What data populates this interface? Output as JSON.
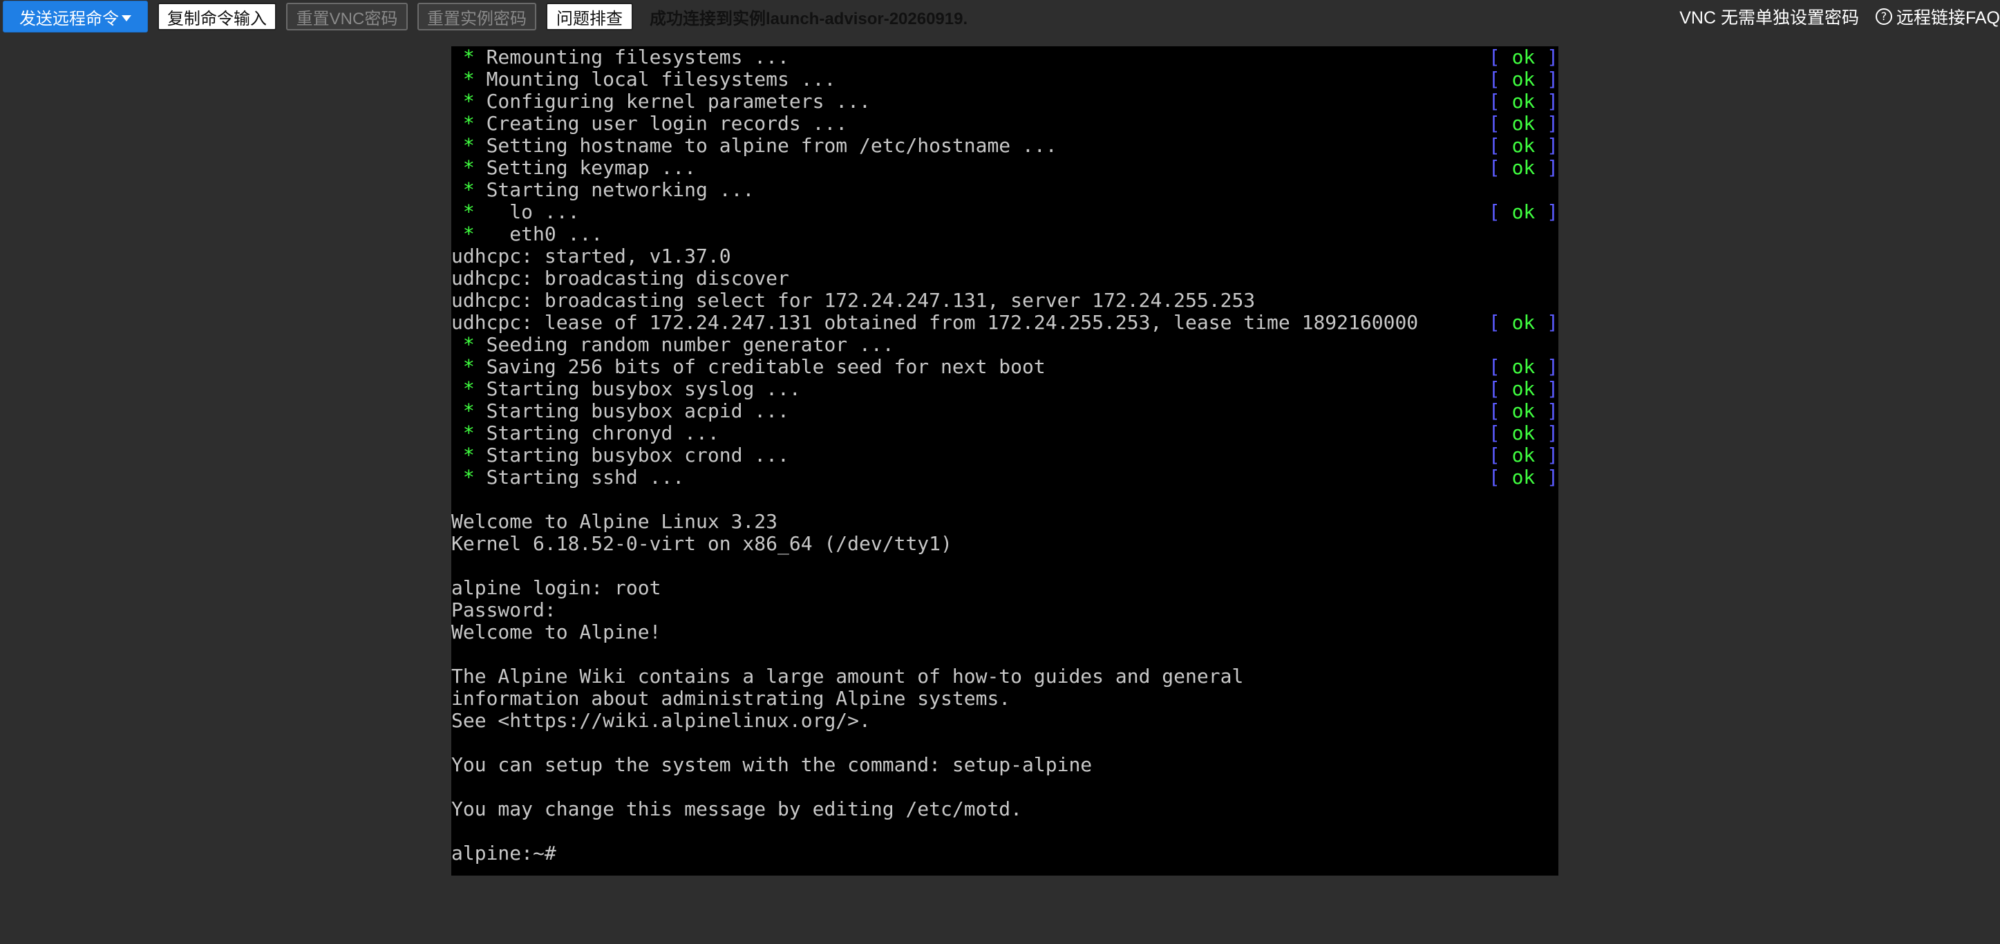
{
  "toolbar": {
    "send_command": "发送远程命令",
    "copy_input": "复制命令输入",
    "reset_vnc": "重置VNC密码",
    "reset_instance": "重置实例密码",
    "troubleshoot": "问题排查",
    "status": "成功连接到实例launch-advisor-20260919."
  },
  "right_tools": {
    "vnc_password": "VNC 无需单独设置密码",
    "faq": "远程链接FAQ",
    "help_glyph": "?"
  },
  "terminal": {
    "lines": [
      {
        "bullet": true,
        "text": "Remounting filesystems ...",
        "ok": true
      },
      {
        "bullet": true,
        "text": "Mounting local filesystems ...",
        "ok": true
      },
      {
        "bullet": true,
        "text": "Configuring kernel parameters ...",
        "ok": true
      },
      {
        "bullet": true,
        "text": "Creating user login records ...",
        "ok": true
      },
      {
        "bullet": true,
        "text": "Setting hostname to alpine from /etc/hostname ...",
        "ok": true
      },
      {
        "bullet": true,
        "text": "Setting keymap ...",
        "ok": true
      },
      {
        "bullet": true,
        "text": "Starting networking ...",
        "ok": false
      },
      {
        "bullet": true,
        "text": "  lo ...",
        "ok": true
      },
      {
        "bullet": true,
        "text": "  eth0 ...",
        "ok": false
      },
      {
        "bullet": false,
        "text": "udhcpc: started, v1.37.0",
        "ok": false
      },
      {
        "bullet": false,
        "text": "udhcpc: broadcasting discover",
        "ok": false
      },
      {
        "bullet": false,
        "text": "udhcpc: broadcasting select for 172.24.247.131, server 172.24.255.253",
        "ok": false
      },
      {
        "bullet": false,
        "text": "udhcpc: lease of 172.24.247.131 obtained from 172.24.255.253, lease time 1892160000",
        "ok": true
      },
      {
        "bullet": true,
        "text": "Seeding random number generator ...",
        "ok": false
      },
      {
        "bullet": true,
        "text": "Saving 256 bits of creditable seed for next boot",
        "ok": true
      },
      {
        "bullet": true,
        "text": "Starting busybox syslog ...",
        "ok": true
      },
      {
        "bullet": true,
        "text": "Starting busybox acpid ...",
        "ok": true
      },
      {
        "bullet": true,
        "text": "Starting chronyd ...",
        "ok": true
      },
      {
        "bullet": true,
        "text": "Starting busybox crond ...",
        "ok": true
      },
      {
        "bullet": true,
        "text": "Starting sshd ...",
        "ok": true
      },
      {
        "bullet": false,
        "text": "",
        "ok": false
      },
      {
        "bullet": false,
        "text": "Welcome to Alpine Linux 3.23",
        "ok": false
      },
      {
        "bullet": false,
        "text": "Kernel 6.18.52-0-virt on x86_64 (/dev/tty1)",
        "ok": false
      },
      {
        "bullet": false,
        "text": "",
        "ok": false
      },
      {
        "bullet": false,
        "text": "alpine login: root",
        "ok": false
      },
      {
        "bullet": false,
        "text": "Password:",
        "ok": false
      },
      {
        "bullet": false,
        "text": "Welcome to Alpine!",
        "ok": false
      },
      {
        "bullet": false,
        "text": "",
        "ok": false
      },
      {
        "bullet": false,
        "text": "The Alpine Wiki contains a large amount of how-to guides and general",
        "ok": false
      },
      {
        "bullet": false,
        "text": "information about administrating Alpine systems.",
        "ok": false
      },
      {
        "bullet": false,
        "text": "See <https://wiki.alpinelinux.org/>.",
        "ok": false
      },
      {
        "bullet": false,
        "text": "",
        "ok": false
      },
      {
        "bullet": false,
        "text": "You can setup the system with the command: setup-alpine",
        "ok": false
      },
      {
        "bullet": false,
        "text": "",
        "ok": false
      },
      {
        "bullet": false,
        "text": "You may change this message by editing /etc/motd.",
        "ok": false
      },
      {
        "bullet": false,
        "text": "",
        "ok": false
      },
      {
        "bullet": false,
        "text": "alpine:~#",
        "ok": false
      }
    ],
    "bullet_glyph": " * ",
    "ok_open": "[ ",
    "ok_word": "ok",
    "ok_close": " ]"
  },
  "colors": {
    "background": "#2e2e2e",
    "primary_button": "#1f7fe5",
    "terminal_bg": "#000000",
    "terminal_text": "#c8c8c8",
    "terminal_green": "#40ff40",
    "terminal_blue": "#5b5bff"
  }
}
